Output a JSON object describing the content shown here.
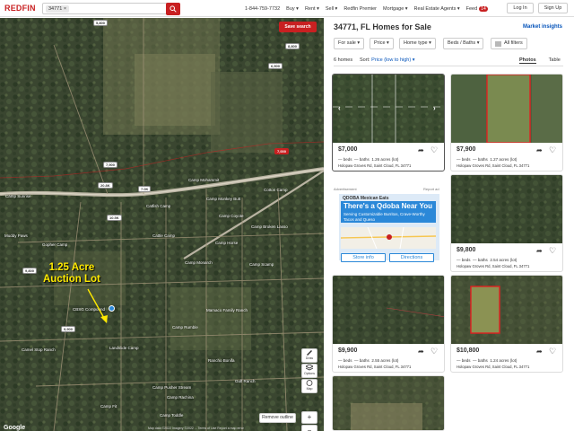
{
  "topbar": {
    "logo": "REDFIN",
    "search_value": "34771",
    "phone": "1-844-759-7732",
    "nav": [
      "Buy ▾",
      "Rent ▾",
      "Sell ▾",
      "Redfin Premier",
      "Mortgage ▾",
      "Real Estate Agents ▾",
      "Feed"
    ],
    "feed_count": "14",
    "login": "Log In",
    "signup": "Sign Up"
  },
  "map": {
    "save_search": "Save search",
    "auction_label_1": "1.25 Acre",
    "auction_label_2": "Auction Lot",
    "remove_outline": "Remove outline",
    "google": "Google",
    "footer": "Map data ©2022 Imagery ©2022 ... Terms of Use  Report a map error",
    "controls": [
      "Draw",
      "Options",
      "Map",
      "+",
      "−"
    ],
    "places": [
      "Gopher Camp",
      "CBSG Compound",
      "Camel Stop Ranch",
      "Camp Mohammit",
      "Camp Monkey Butt",
      "Cotton Camp",
      "Catfish Camp",
      "Camp Coyote",
      "Camp Broken Lasso",
      "Cattle Camp",
      "Camp Horse",
      "Camp Monarch",
      "Camp Scamp",
      "Landslide Camp",
      "Rancho Bonifa",
      "Mamaco Family Ranch",
      "Camp Rumble",
      "Camp Pusher Stream",
      "Camp Fit",
      "Camp Toddle",
      "Gulf Ranch",
      "Muddy Paws",
      "Camp Sunrise",
      "Camp Rachina"
    ],
    "price_pins": [
      "5,800",
      "8,800",
      "6,500",
      "7,000",
      "7,900",
      "20.8K",
      "7.0K",
      "9,900",
      "10.5K",
      "9,800"
    ]
  },
  "panel": {
    "title": "34771, FL Homes for Sale",
    "market_insights": "Market insights",
    "filters": [
      "For sale ▾",
      "Price ▾",
      "Home type ▾",
      "Beds / Baths ▾",
      "All filters"
    ],
    "homes_count": "6 homes",
    "sort_label": "Sort:",
    "sort_value": "Price (low to high) ▾",
    "tabs": [
      "Photos",
      "Table"
    ]
  },
  "listings": [
    {
      "price": "$7,000",
      "beds": "— beds",
      "baths": "— baths",
      "acres": "1.26 acres (lot)",
      "address": "Holopaw Groves Rd, Saint Cloud, FL 34771"
    },
    {
      "price": "$7,900",
      "beds": "— beds",
      "baths": "— baths",
      "acres": "1.27 acres (lot)",
      "address": "Holopaw Groves Rd, Saint Cloud, FL 34771"
    },
    {
      "price": "$9,800",
      "beds": "— beds",
      "baths": "— baths",
      "acres": "2.54 acres (lot)",
      "address": "Holopaw Groves Rd, Saint Cloud, FL 34771"
    },
    {
      "price": "$9,900",
      "beds": "— beds",
      "baths": "— baths",
      "acres": "2.55 acres (lot)",
      "address": "Holopaw Groves Rd, Saint Cloud, FL 34771"
    },
    {
      "price": "$10,800",
      "beds": "— beds",
      "baths": "— baths",
      "acres": "1.24 acres (lot)",
      "address": "Holopaw Groves Rd, Saint Cloud, FL 34771"
    }
  ],
  "ad": {
    "label": "Advertisement",
    "info": "Report ad",
    "brand": "QDOBA Mexican Eats",
    "headline": "There's a Qdoba Near You",
    "sub": "Serving Customizable Burritos, Crave-Worthy Tacos and Queso",
    "store_info": "Store info",
    "directions": "Directions"
  },
  "colors": {
    "brand_red": "#c82021",
    "link_blue": "#0654ba",
    "ad_blue": "#2b88d8",
    "auction_yellow": "#ffea00"
  }
}
